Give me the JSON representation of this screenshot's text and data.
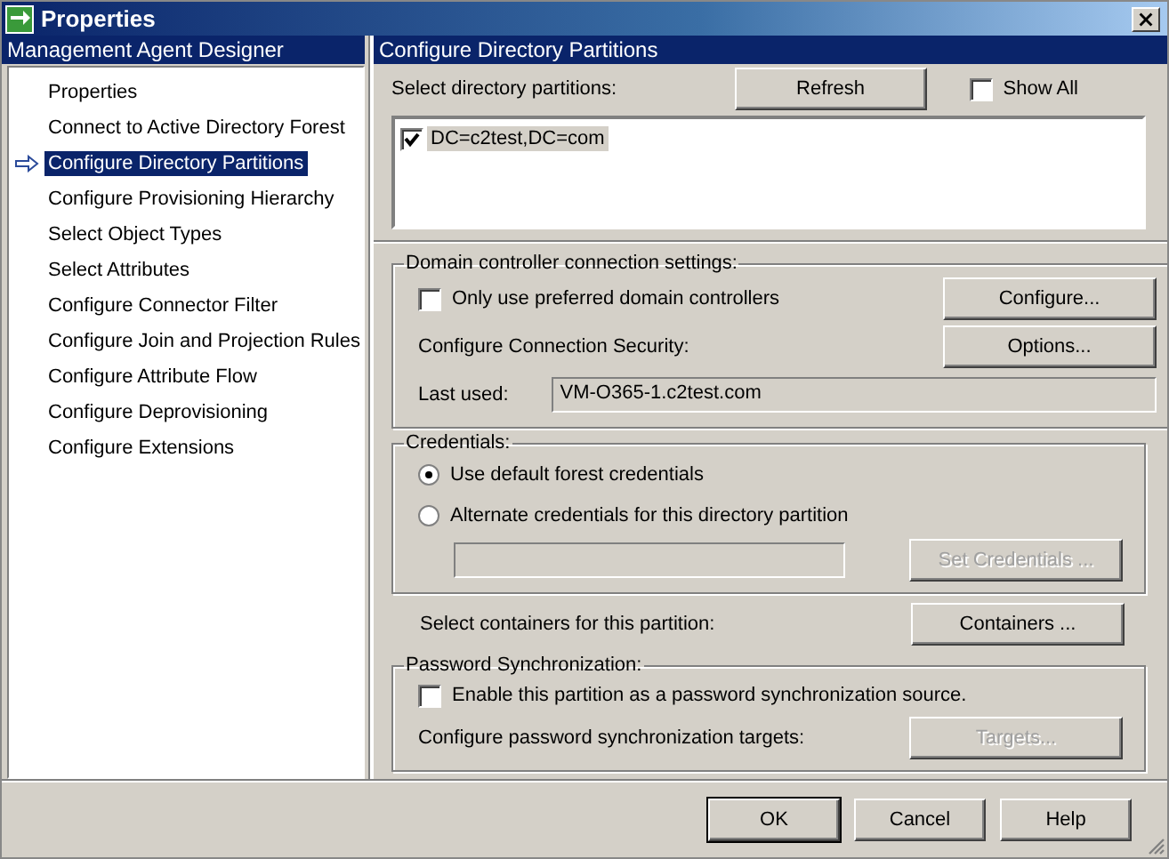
{
  "window": {
    "title": "Properties"
  },
  "nav": {
    "header": "Management Agent Designer",
    "items": [
      {
        "label": "Properties",
        "selected": false
      },
      {
        "label": "Connect to Active Directory Forest",
        "selected": false
      },
      {
        "label": "Configure Directory Partitions",
        "selected": true
      },
      {
        "label": "Configure Provisioning Hierarchy",
        "selected": false
      },
      {
        "label": "Select Object Types",
        "selected": false
      },
      {
        "label": "Select Attributes",
        "selected": false
      },
      {
        "label": "Configure Connector Filter",
        "selected": false
      },
      {
        "label": "Configure Join and Projection Rules",
        "selected": false
      },
      {
        "label": "Configure Attribute Flow",
        "selected": false
      },
      {
        "label": "Configure Deprovisioning",
        "selected": false
      },
      {
        "label": "Configure Extensions",
        "selected": false
      }
    ]
  },
  "page": {
    "header": "Configure Directory Partitions",
    "partitions_label": "Select directory partitions:",
    "refresh_button": "Refresh",
    "show_all": {
      "label": "Show All",
      "checked": false
    },
    "partitions": [
      {
        "label": "DC=c2test,DC=com",
        "checked": true,
        "selected": true
      }
    ],
    "dc_group": {
      "title": "Domain controller connection settings:",
      "preferred": {
        "label": "Only use preferred domain controllers",
        "checked": false
      },
      "configure_button": "Configure...",
      "security_label": "Configure Connection Security:",
      "options_button": "Options...",
      "last_used_label": "Last used:",
      "last_used_value": "VM-O365-1.c2test.com"
    },
    "credentials": {
      "title": "Credentials:",
      "options": [
        {
          "label": "Use default forest credentials",
          "selected": true
        },
        {
          "label": "Alternate credentials for this directory partition",
          "selected": false
        }
      ],
      "alternate_field": {
        "disabled": true
      },
      "set_button": {
        "label": "Set Credentials ...",
        "disabled": true
      }
    },
    "containers_label": "Select containers for this partition:",
    "containers_button": {
      "label": "Containers ...",
      "disabled": false
    },
    "password": {
      "title": "Password Synchronization:",
      "enable": {
        "label": "Enable this partition as a password synchronization source.",
        "checked": false
      },
      "targets_label": "Configure password synchronization targets:",
      "targets_button": {
        "label": "Targets...",
        "disabled": true
      }
    }
  },
  "buttons": [
    {
      "label": "OK",
      "default": true
    },
    {
      "label": "Cancel",
      "default": false
    },
    {
      "label": "Help",
      "default": false
    }
  ]
}
